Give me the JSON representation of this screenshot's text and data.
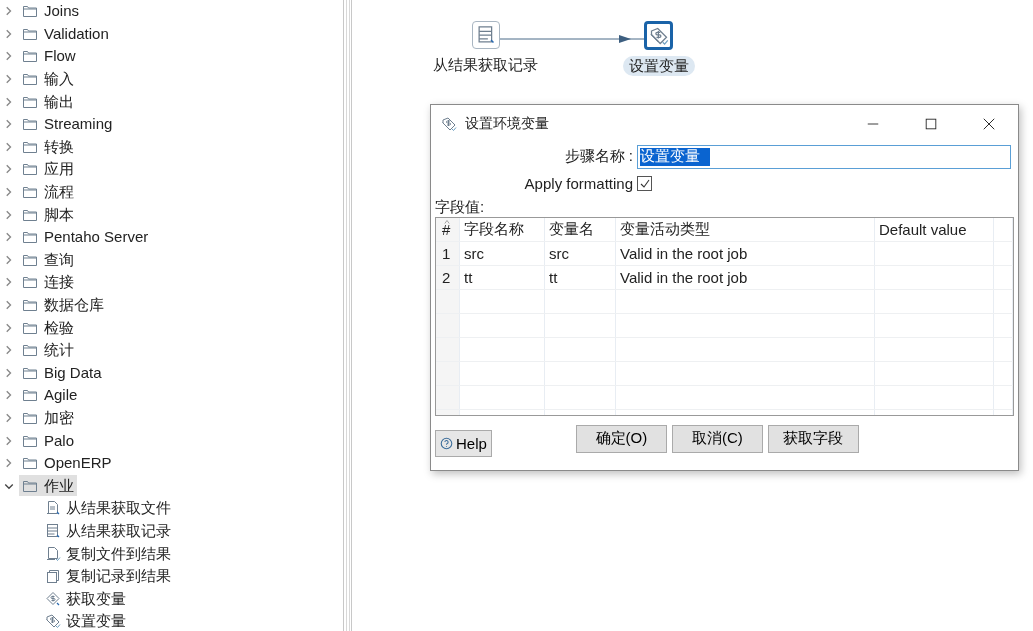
{
  "tree": [
    {
      "label": "Joins",
      "expanded": false,
      "selected": false
    },
    {
      "label": "Validation",
      "expanded": false,
      "selected": false
    },
    {
      "label": "Flow",
      "expanded": false,
      "selected": false
    },
    {
      "label": "输入",
      "expanded": false,
      "selected": false
    },
    {
      "label": "输出",
      "expanded": false,
      "selected": false
    },
    {
      "label": "Streaming",
      "expanded": false,
      "selected": false
    },
    {
      "label": "转换",
      "expanded": false,
      "selected": false
    },
    {
      "label": "应用",
      "expanded": false,
      "selected": false
    },
    {
      "label": "流程",
      "expanded": false,
      "selected": false
    },
    {
      "label": "脚本",
      "expanded": false,
      "selected": false
    },
    {
      "label": "Pentaho Server",
      "expanded": false,
      "selected": false
    },
    {
      "label": "查询",
      "expanded": false,
      "selected": false
    },
    {
      "label": "连接",
      "expanded": false,
      "selected": false
    },
    {
      "label": "数据仓库",
      "expanded": false,
      "selected": false
    },
    {
      "label": "检验",
      "expanded": false,
      "selected": false
    },
    {
      "label": "统计",
      "expanded": false,
      "selected": false
    },
    {
      "label": "Big Data",
      "expanded": false,
      "selected": false
    },
    {
      "label": "Agile",
      "expanded": false,
      "selected": false
    },
    {
      "label": "加密",
      "expanded": false,
      "selected": false
    },
    {
      "label": "Palo",
      "expanded": false,
      "selected": false
    },
    {
      "label": "OpenERP",
      "expanded": false,
      "selected": false
    },
    {
      "label": "作业",
      "expanded": true,
      "selected": true,
      "children": [
        {
          "label": "从结果获取文件",
          "kind": "filein"
        },
        {
          "label": "从结果获取记录",
          "kind": "rowsin"
        },
        {
          "label": "复制文件到结果",
          "kind": "fileout"
        },
        {
          "label": "复制记录到结果",
          "kind": "rowsout"
        },
        {
          "label": "获取变量",
          "kind": "varget"
        },
        {
          "label": "设置变量",
          "kind": "varset"
        }
      ]
    }
  ],
  "canvas": {
    "nodes": [
      {
        "label": "从结果获取记录",
        "kind": "rowsin",
        "selected": false
      },
      {
        "label": "设置变量",
        "kind": "varset",
        "selected": true
      }
    ]
  },
  "dialog": {
    "title": "设置环境变量",
    "step_name": {
      "label": "步骤名称 :",
      "value": "设置变量"
    },
    "apply_formatting": {
      "label": "Apply formatting",
      "checked": true
    },
    "fields_label": "字段值:",
    "table": {
      "columns": [
        "#",
        "字段名称",
        "变量名",
        "变量活动类型",
        "Default value"
      ],
      "rows": [
        [
          "1",
          "src",
          "src",
          "Valid in the root job",
          ""
        ],
        [
          "2",
          "tt",
          "tt",
          "Valid in the root job",
          ""
        ]
      ]
    },
    "help_button": "Help",
    "buttons": [
      "确定(O)",
      "取消(C)",
      "获取字段"
    ]
  }
}
